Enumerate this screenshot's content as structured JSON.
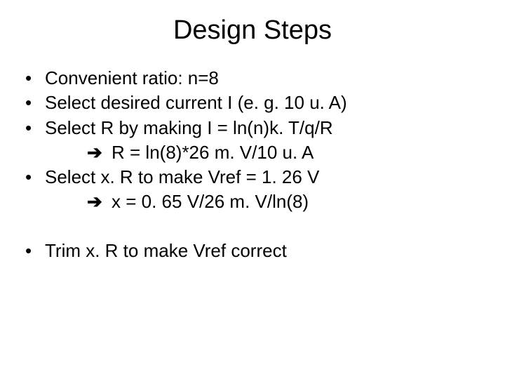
{
  "title": "Design Steps",
  "bullets": {
    "b1": "Convenient ratio: n=8",
    "b2": "Select desired current I (e. g. 10 u. A)",
    "b3": "Select R by making I = ln(n)k. T/q/R",
    "b3_sub_arrow": "➔",
    "b3_sub": " R = ln(8)*26 m. V/10 u. A",
    "b4": "Select x. R to make Vref = 1. 26 V",
    "b4_sub_arrow": "➔",
    "b4_sub": " x = 0. 65 V/26 m. V/ln(8)",
    "b5": "Trim x. R to make Vref correct"
  },
  "dot": "•"
}
